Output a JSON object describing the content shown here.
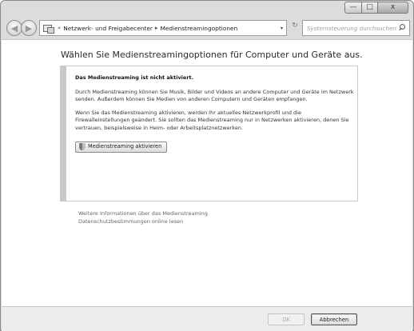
{
  "window": {
    "controls": {
      "minimize_icon": "minimize-icon",
      "maximize_icon": "maximize-icon",
      "close_icon": "close-icon"
    },
    "min_glyph": "—",
    "max_glyph": "□",
    "close_glyph": "x"
  },
  "nav": {
    "back_glyph": "◀",
    "forward_glyph": "▶",
    "address_prefix": "«",
    "breadcrumb": [
      "Netzwerk- und Freigabecenter",
      "Medienstreamingoptionen"
    ],
    "separator": "▸",
    "dropdown_glyph": "▾",
    "refresh_glyph": "↻",
    "search_placeholder": "Systemsteuerung durchsuchen"
  },
  "main": {
    "title": "Wählen Sie Medienstreamingoptionen für Computer und Geräte aus.",
    "info": {
      "heading": "Das Medienstreaming ist nicht aktiviert.",
      "paragraph1": "Durch Medienstreaming können Sie Musik, Bilder und Videos an andere Computer und Geräte im Netzwerk senden. Außerdem können Sie Medien von anderen Computern und Geräten empfangen.",
      "paragraph2": "Wenn Sie das Medienstreaming aktivieren, werden Ihr aktuelles Netzwerkprofil und die Firewalleinstellungen geändert. Sie sollten das Medienstreaming nur in Netzwerken aktivieren, denen Sie vertrauen, beispielsweise in Heim- oder Arbeitsplatznetzwerken.",
      "button_label": "Medienstreaming aktivieren"
    },
    "links": [
      "Weitere Informationen über das Medienstreaming",
      "Datenschutzbestimmungen online lesen"
    ]
  },
  "footer": {
    "ok_label": "OK",
    "cancel_label": "Abbrechen"
  }
}
